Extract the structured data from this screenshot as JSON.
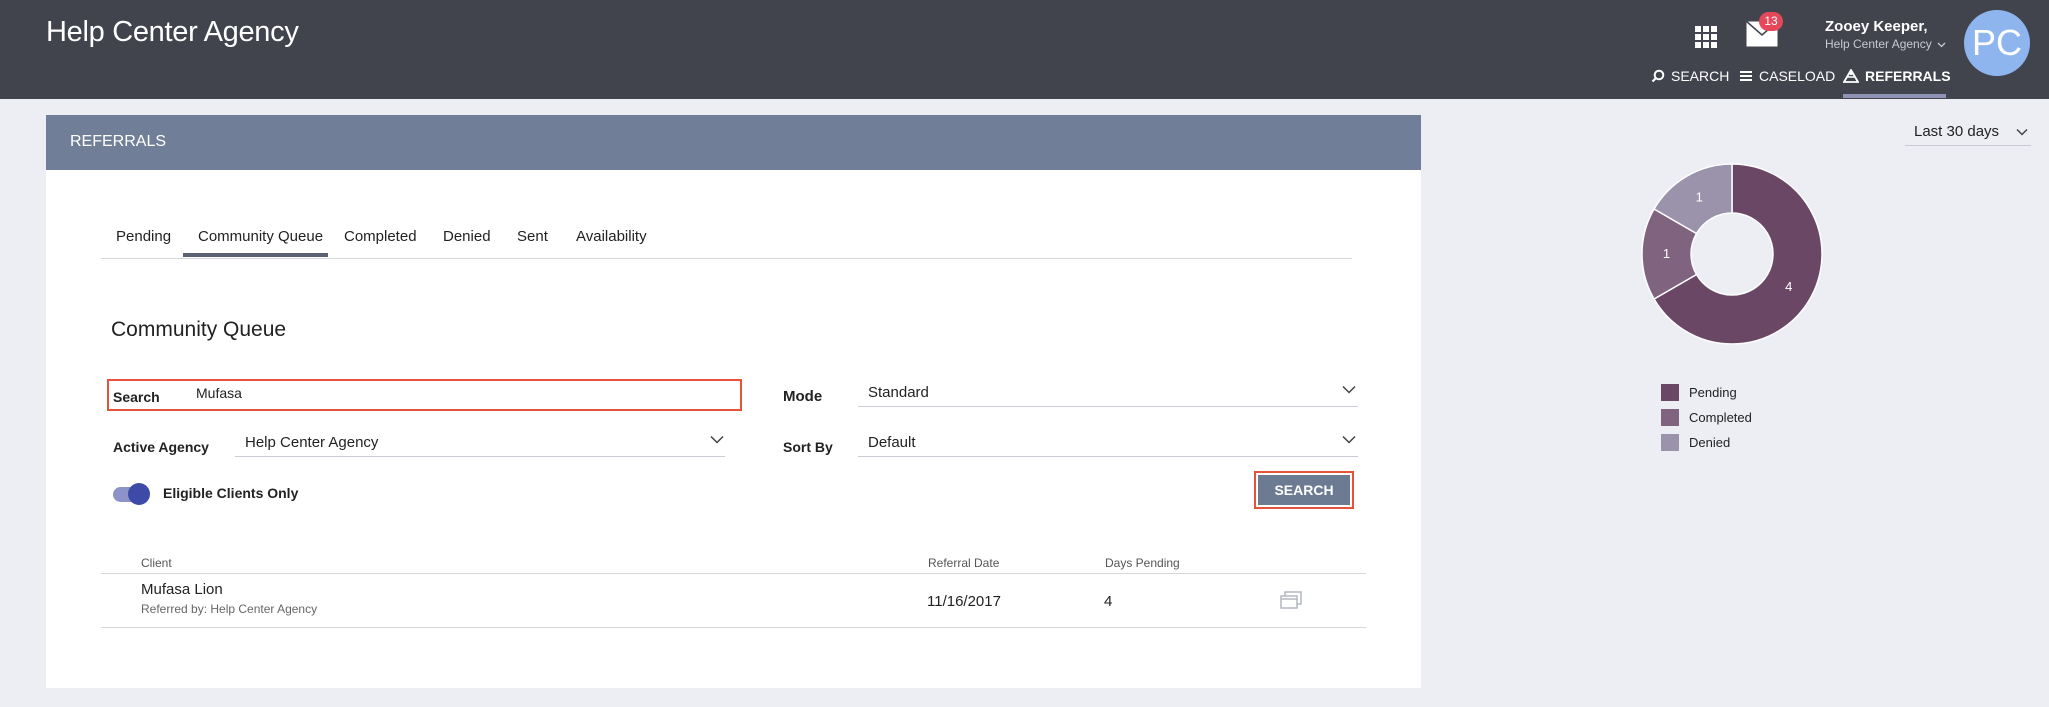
{
  "app": {
    "title": "Help Center Agency"
  },
  "header": {
    "mail_count": "13",
    "user_name": "Zooey Keeper,",
    "user_agency": "Help Center Agency",
    "avatar_initials": "PC",
    "nav": [
      {
        "label": "SEARCH",
        "icon": "search-icon"
      },
      {
        "label": "CASELOAD",
        "icon": "list-icon"
      },
      {
        "label": "REFERRALS",
        "icon": "referrals-icon",
        "active": true
      }
    ]
  },
  "panel": {
    "header": "REFERRALS"
  },
  "tabs": [
    "Pending",
    "Community Queue",
    "Completed",
    "Denied",
    "Sent",
    "Availability"
  ],
  "active_tab": "Community Queue",
  "section_title": "Community Queue",
  "filters": {
    "search_label": "Search",
    "search_value": "Mufasa",
    "mode_label": "Mode",
    "mode_value": "Standard",
    "agency_label": "Active Agency",
    "agency_value": "Help Center Agency",
    "sort_label": "Sort By",
    "sort_value": "Default",
    "eligible_label": "Eligible Clients Only",
    "eligible_on": true,
    "search_button": "SEARCH"
  },
  "table": {
    "headers": {
      "client": "Client",
      "referral_date": "Referral Date",
      "days_pending": "Days Pending"
    },
    "rows": [
      {
        "client": "Mufasa Lion",
        "referred_by": "Referred by: Help Center Agency",
        "referral_date": "11/16/2017",
        "days_pending": "4"
      }
    ]
  },
  "date_range": "Last 30 days",
  "chart_data": {
    "type": "pie",
    "donut": true,
    "slices": [
      {
        "label": "Pending",
        "value": 4,
        "color": "#6b4766"
      },
      {
        "label": "Completed",
        "value": 1,
        "color": "#80637e"
      },
      {
        "label": "Denied",
        "value": 1,
        "color": "#9b92ac"
      }
    ],
    "legend_position": "bottom"
  },
  "colors": {
    "topbar": "#41434d",
    "panel_header": "#707f97",
    "highlight": "#e5533d"
  }
}
